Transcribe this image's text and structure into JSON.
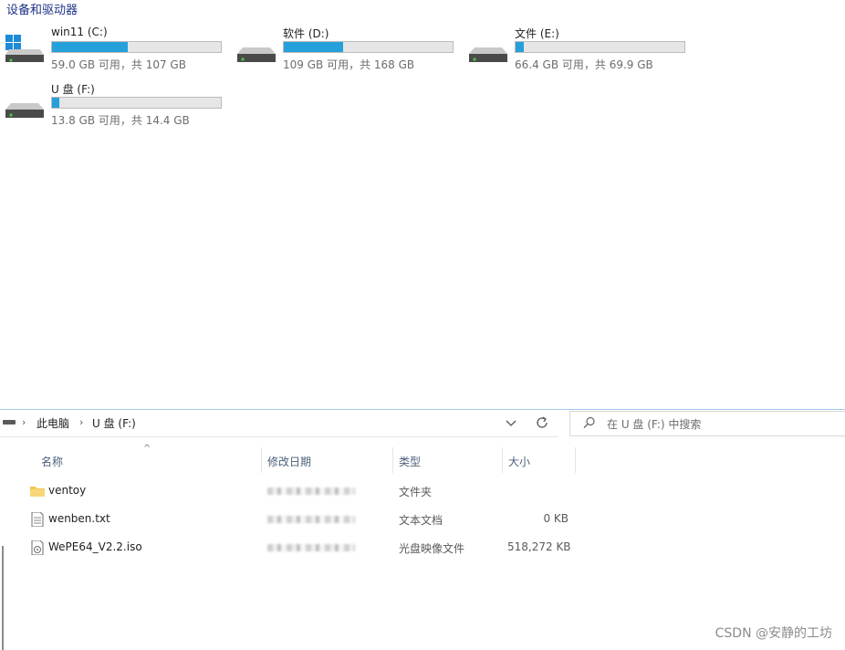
{
  "section": {
    "title": "设备和驱动器"
  },
  "drives": [
    {
      "name": "win11 (C:)",
      "size_text": "59.0 GB 可用，共 107 GB",
      "used_fraction": 0.449,
      "icon": "windows-drive-icon"
    },
    {
      "name": "软件 (D:)",
      "size_text": "109 GB 可用，共 168 GB",
      "used_fraction": 0.351,
      "icon": "hard-drive-icon"
    },
    {
      "name": "文件 (E:)",
      "size_text": "66.4 GB 可用，共 69.9 GB",
      "used_fraction": 0.05,
      "icon": "hard-drive-icon"
    },
    {
      "name": "U 盘 (F:)",
      "size_text": "13.8 GB 可用，共 14.4 GB",
      "used_fraction": 0.042,
      "icon": "usb-drive-icon"
    }
  ],
  "address": {
    "crumbs": [
      "此电脑",
      "U 盘 (F:)"
    ],
    "search_placeholder": "在 U 盘 (F:) 中搜索"
  },
  "columns": {
    "name": "名称",
    "date": "修改日期",
    "type": "类型",
    "size": "大小"
  },
  "files": [
    {
      "name": "ventoy",
      "type": "文件夹",
      "size": "",
      "icon": "folder-icon"
    },
    {
      "name": "wenben.txt",
      "type": "文本文档",
      "size": "0 KB",
      "icon": "text-file-icon"
    },
    {
      "name": "WePE64_V2.2.iso",
      "type": "光盘映像文件",
      "size": "518,272 KB",
      "icon": "disc-image-icon"
    }
  ],
  "watermark": "CSDN @安静的工坊",
  "colors": {
    "accent": "#26a0da",
    "title": "#1e3287",
    "bar_bg": "#e6e6e6"
  }
}
